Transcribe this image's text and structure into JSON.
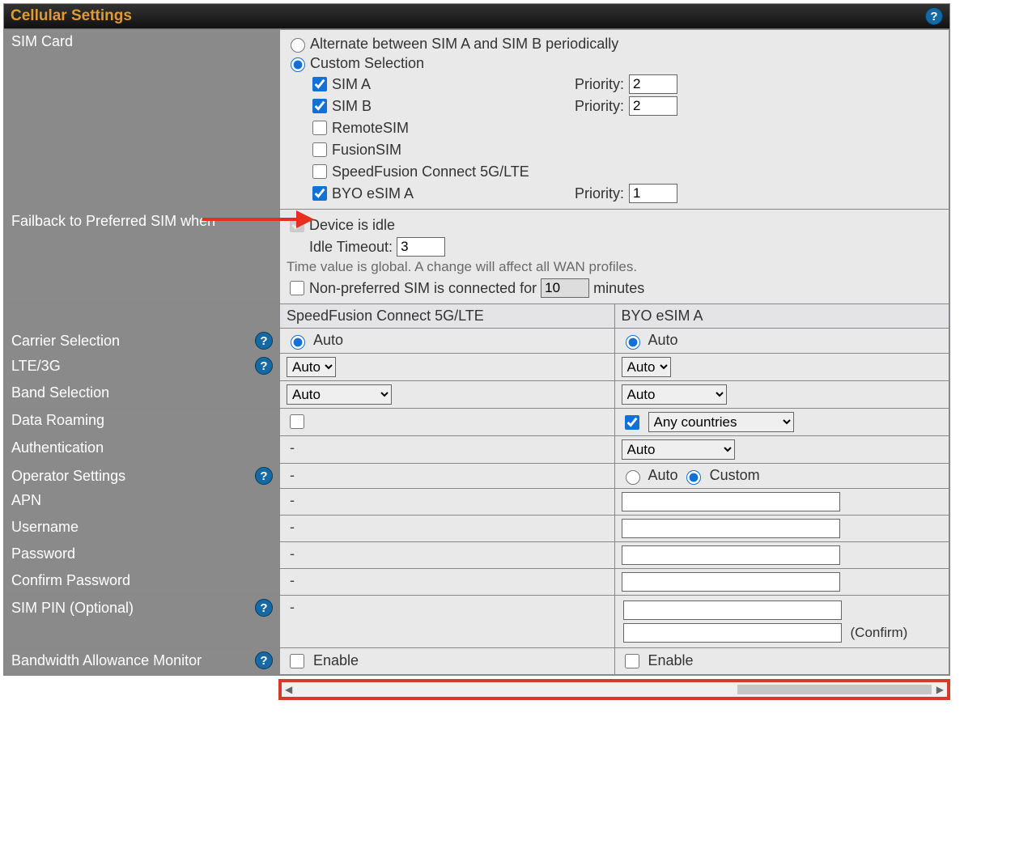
{
  "header": {
    "title": "Cellular Settings"
  },
  "simCard": {
    "label": "SIM Card",
    "alternate": {
      "label": "Alternate between SIM A and SIM B periodically",
      "checked": false
    },
    "customSelection": {
      "label": "Custom Selection",
      "checked": true
    },
    "priorityLabel": "Priority:",
    "items": [
      {
        "label": "SIM A",
        "checked": true,
        "priority": "2"
      },
      {
        "label": "SIM B",
        "checked": true,
        "priority": "2"
      },
      {
        "label": "RemoteSIM",
        "checked": false
      },
      {
        "label": "FusionSIM",
        "checked": false
      },
      {
        "label": "SpeedFusion Connect 5G/LTE",
        "checked": false
      },
      {
        "label": "BYO eSIM A",
        "checked": true,
        "priority": "1"
      }
    ]
  },
  "failback": {
    "label": "Failback to Preferred SIM when",
    "idleLabel": "Device is idle",
    "idleTimeoutLabel": "Idle Timeout:",
    "idleTimeout": "3",
    "hint": "Time value is global. A change will affect all WAN profiles.",
    "nonPreferredLabel": "Non-preferred SIM is connected for",
    "nonPreferredValue": "10",
    "minutesLabel": "minutes"
  },
  "columns": {
    "col1": "SpeedFusion Connect 5G/LTE",
    "col2": "BYO eSIM A"
  },
  "rows": {
    "carrierSelection": {
      "label": "Carrier Selection",
      "c1_auto": "Auto",
      "c2_auto": "Auto"
    },
    "lte3g": {
      "label": "LTE/3G",
      "c1_value": "Auto",
      "c2_value": "Auto"
    },
    "bandSelection": {
      "label": "Band Selection",
      "c1_value": "Auto",
      "c2_value": "Auto"
    },
    "dataRoaming": {
      "label": "Data Roaming",
      "c1_checked": false,
      "c2_checked": true,
      "c2_select": "Any countries"
    },
    "authentication": {
      "label": "Authentication",
      "c1_dash": "-",
      "c2_value": "Auto"
    },
    "operatorSettings": {
      "label": "Operator Settings",
      "c1_dash": "-",
      "c2_auto": "Auto",
      "c2_custom": "Custom"
    },
    "apn": {
      "label": "APN",
      "c1_dash": "-",
      "c2_value": ""
    },
    "username": {
      "label": "Username",
      "c1_dash": "-",
      "c2_value": ""
    },
    "password": {
      "label": "Password",
      "c1_dash": "-",
      "c2_value": ""
    },
    "confirmPassword": {
      "label": "Confirm Password",
      "c1_dash": "-",
      "c2_value": ""
    },
    "simPin": {
      "label": "SIM PIN (Optional)",
      "c1_dash": "-",
      "c2_value": "",
      "c2_confirm_value": "",
      "confirmNote": "(Confirm)"
    },
    "bandwidth": {
      "label": "Bandwidth Allowance Monitor",
      "enableLabel": "Enable",
      "c1_checked": false,
      "c2_checked": false
    }
  }
}
